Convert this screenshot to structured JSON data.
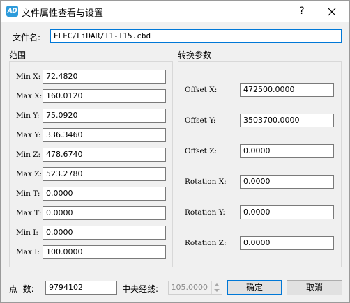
{
  "window": {
    "app_icon_text": "AD",
    "title": "文件属性查看与设置",
    "help_label": "?"
  },
  "file": {
    "label": "文件名:",
    "value": "ELEC/LiDAR/T1-T15.cbd"
  },
  "range": {
    "title": "范围",
    "fields": [
      {
        "label": "Min X:",
        "value": "72.4820"
      },
      {
        "label": "Max X:",
        "value": "160.0120"
      },
      {
        "label": "Min Y:",
        "value": "75.0920"
      },
      {
        "label": "Max Y:",
        "value": "336.3460"
      },
      {
        "label": "Min Z:",
        "value": "478.6740"
      },
      {
        "label": "Max Z:",
        "value": "523.2780"
      },
      {
        "label": "Min T:",
        "value": "0.0000"
      },
      {
        "label": "Max T:",
        "value": "0.0000"
      },
      {
        "label": "Min I:",
        "value": "0.0000"
      },
      {
        "label": "Max I:",
        "value": "100.0000"
      }
    ]
  },
  "transform": {
    "title": "转换参数",
    "fields": [
      {
        "label": "Offset X:",
        "value": "472500.0000"
      },
      {
        "label": "Offset Y:",
        "value": "3503700.0000"
      },
      {
        "label": "Offset Z:",
        "value": "0.0000"
      },
      {
        "label": "Rotation X:",
        "value": "0.0000"
      },
      {
        "label": "Rotation Y:",
        "value": "0.0000"
      },
      {
        "label": "Rotation Z:",
        "value": "0.0000"
      }
    ]
  },
  "footer": {
    "points_label": "点  数:",
    "points_value": "9794102",
    "meridian_label": "中央经线:",
    "meridian_value": "105.0000",
    "ok_label": "确定",
    "cancel_label": "取消"
  }
}
